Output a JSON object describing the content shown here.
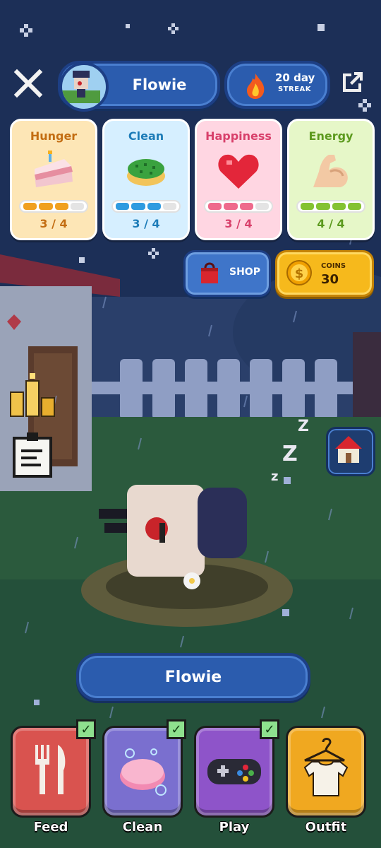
{
  "header": {
    "profile_name": "Flowie",
    "streak_days": "20 day",
    "streak_label": "STREAK"
  },
  "stats": [
    {
      "label": "Hunger",
      "value": "3 / 4",
      "filled": 3,
      "total": 4,
      "title_color": "#c36d12",
      "bg": "#fde6b6",
      "fill": "#f0a020",
      "icon": "cake-icon"
    },
    {
      "label": "Clean",
      "value": "3 / 4",
      "filled": 3,
      "total": 4,
      "title_color": "#1d7cb8",
      "bg": "#d6efff",
      "fill": "#2f9be0",
      "icon": "sponge-icon"
    },
    {
      "label": "Happiness",
      "value": "3 / 4",
      "filled": 3,
      "total": 4,
      "title_color": "#d8406b",
      "bg": "#ffd6e2",
      "fill": "#ee6b8c",
      "icon": "heart-icon"
    },
    {
      "label": "Energy",
      "value": "4 / 4",
      "filled": 4,
      "total": 4,
      "title_color": "#5c9a1e",
      "bg": "#e6f7c8",
      "fill": "#84c232",
      "icon": "flexed-arm-icon"
    }
  ],
  "shop": {
    "label": "SHOP"
  },
  "coins": {
    "label": "COINS",
    "value": "30"
  },
  "pet": {
    "name": "Flowie"
  },
  "actions": [
    {
      "label": "Feed",
      "done": true,
      "color": "#d9534f",
      "icon": "fork-knife-icon"
    },
    {
      "label": "Clean",
      "done": true,
      "color": "#7a6fcf",
      "icon": "soap-icon"
    },
    {
      "label": "Play",
      "done": true,
      "color": "#8e54c9",
      "icon": "gamepad-icon"
    },
    {
      "label": "Outfit",
      "done": false,
      "color": "#f0a820",
      "icon": "shirt-icon"
    }
  ],
  "checkmark": "✓"
}
